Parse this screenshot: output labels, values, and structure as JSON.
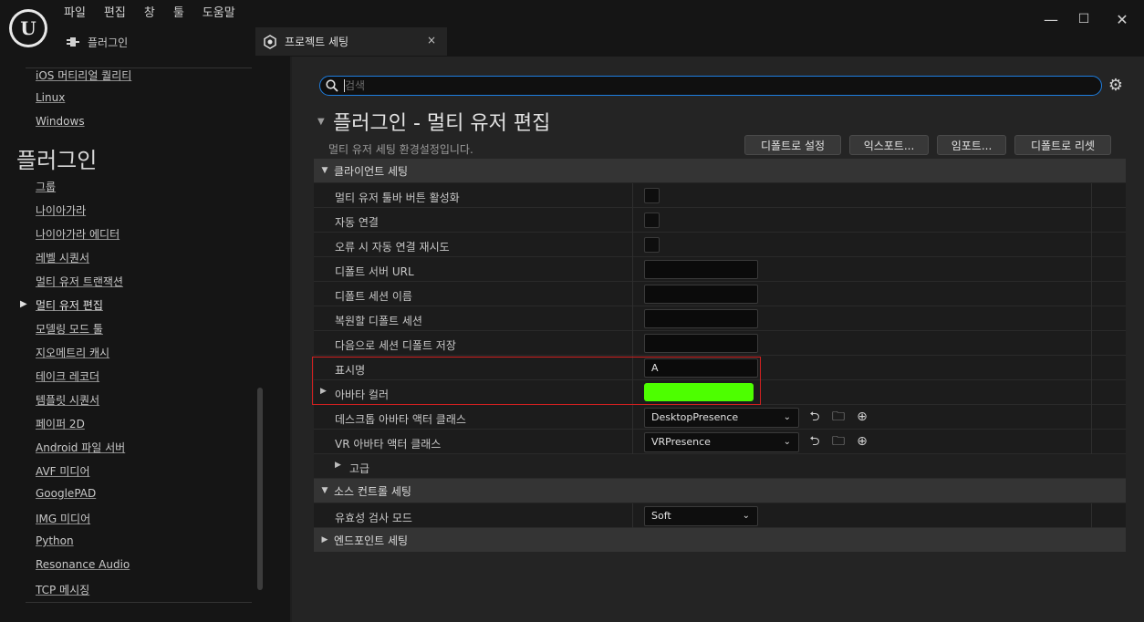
{
  "menu": [
    "파일",
    "편집",
    "창",
    "툴",
    "도움말"
  ],
  "window_controls": {
    "minimize": "—",
    "maximize": "☐",
    "close": "✕"
  },
  "tabs": {
    "plugin": {
      "label": "플러그인",
      "icon": "plug-icon"
    },
    "project_settings": {
      "label": "프로젝트 세팅",
      "icon": "settings-cube-icon",
      "close": "×"
    }
  },
  "sidebar": {
    "items_top": [
      "iOS 머티리얼 퀄리티",
      "Linux",
      "Windows"
    ],
    "heading": "플러그인",
    "items": [
      "그룹",
      "나이아가라",
      "나이아가라 에디터",
      "레벨 시퀀서",
      "멀티 유저 트랜잭션",
      "멀티 유저 편집",
      "모델링 모드 툴",
      "지오메트리 캐시",
      "테이크 레코더",
      "템플릿 시퀀서",
      "페이퍼 2D",
      "Android 파일 서버",
      "AVF 미디어",
      "GooglePAD",
      "IMG 미디어",
      "Python",
      "Resonance Audio",
      "TCP 메시징"
    ],
    "selected": "멀티 유저 편집"
  },
  "search": {
    "placeholder": "검색",
    "value": ""
  },
  "section": {
    "title": "플러그인 - 멀티 유저 편집",
    "description": "멀티 유저 세팅 환경설정입니다.",
    "buttons": {
      "set_default": "디폴트로 설정",
      "export": "익스포트...",
      "import": "임포트...",
      "reset_default": "디폴트로 리셋"
    }
  },
  "categories": {
    "client": "클라이언트 세팅",
    "source_control": "소스 컨트롤 세팅",
    "endpoint": "엔드포인트 세팅"
  },
  "client_settings": {
    "toolbar_button": {
      "label": "멀티 유저 툴바 버튼 활성화",
      "checked": false
    },
    "auto_connect": {
      "label": "자동 연결",
      "checked": false
    },
    "retry_auto_connect": {
      "label": "오류 시 자동 연결 재시도",
      "checked": false
    },
    "default_server_url": {
      "label": "디폴트 서버 URL",
      "value": ""
    },
    "default_session_name": {
      "label": "디폴트 세션 이름",
      "value": ""
    },
    "default_session_restore": {
      "label": "복원할 디폴트 세션",
      "value": ""
    },
    "default_save_session": {
      "label": "다음으로 세션 디폴트 저장",
      "value": ""
    },
    "display_name": {
      "label": "표시명",
      "value": "A"
    },
    "avatar_color": {
      "label": "아바타 컬러",
      "color": "#4dff00"
    },
    "desktop_avatar": {
      "label": "데스크톱 아바타 액터 클래스",
      "value": "DesktopPresence"
    },
    "vr_avatar": {
      "label": "VR 아바타 액터 클래스",
      "value": "VRPresence"
    },
    "advanced": {
      "label": "고급"
    }
  },
  "source_control": {
    "validation_mode": {
      "label": "유효성 검사 모드",
      "value": "Soft"
    }
  }
}
